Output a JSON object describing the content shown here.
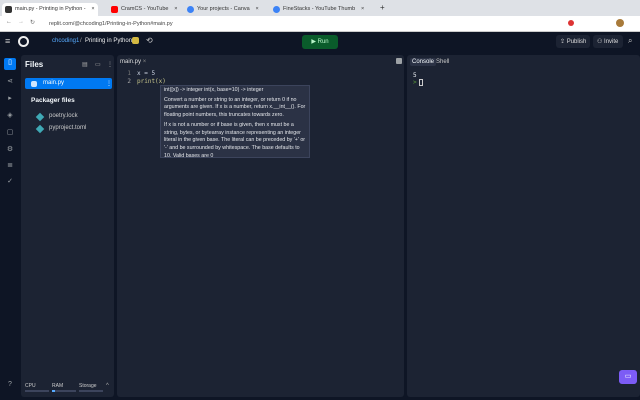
{
  "browser": {
    "tabs": [
      {
        "title": "main.py - Printing in Python -",
        "active": true,
        "color": "#333333"
      },
      {
        "title": "CramCS - YouTube",
        "active": false,
        "color": "#ff0000"
      },
      {
        "title": "Your projects - Canva",
        "active": false,
        "color": "#3b82f6"
      },
      {
        "title": "FineStacks - YouTube Thumb",
        "active": false,
        "color": "#3b82f6"
      }
    ],
    "new_tab": "+",
    "url": "replit.com/@chcoding1/Printing-in-Python#main.py"
  },
  "header": {
    "user": "chcoding1",
    "separator": "/",
    "repl_name": "Printing in Python",
    "run_label": "Run",
    "publish_label": "Publish",
    "invite_label": "Invite"
  },
  "files": {
    "title": "Files",
    "items": [
      {
        "name": "main.py",
        "selected": true
      }
    ],
    "packager_title": "Packager files",
    "packager_items": [
      {
        "name": "poetry.lock"
      },
      {
        "name": "pyproject.toml"
      }
    ]
  },
  "editor": {
    "tab": "main.py",
    "lines": [
      {
        "num": "1",
        "code": "x = 5"
      },
      {
        "num": "2",
        "code": "print(x)"
      }
    ]
  },
  "tooltip": {
    "signature": "int([x]) -> integer int(x, base=10) -> integer",
    "para1": "Convert a number or string to an integer, or return 0 if no arguments are given.  If x is a number, return x.__int__().  For floating point numbers, this truncates towards zero.",
    "para2": "If x is not a number or if base is given, then x must be a string, bytes, or bytearray instance representing an integer literal in the given base.  The literal can be preceded by '+' or '-' and be surrounded by whitespace.  The base defaults to 10.  Valid bases are 0"
  },
  "console": {
    "tabs": [
      "Console",
      "Shell"
    ],
    "output": "5",
    "prompt": ">"
  },
  "footer": {
    "cpu": "CPU",
    "ram": "RAM",
    "storage": "Storage",
    "help": "?"
  },
  "colors": {
    "accent": "#0079f2",
    "run": "#0a5c2b",
    "bg": "#0e1525",
    "panel": "#1c2333",
    "chat": "#7c5cf5"
  }
}
